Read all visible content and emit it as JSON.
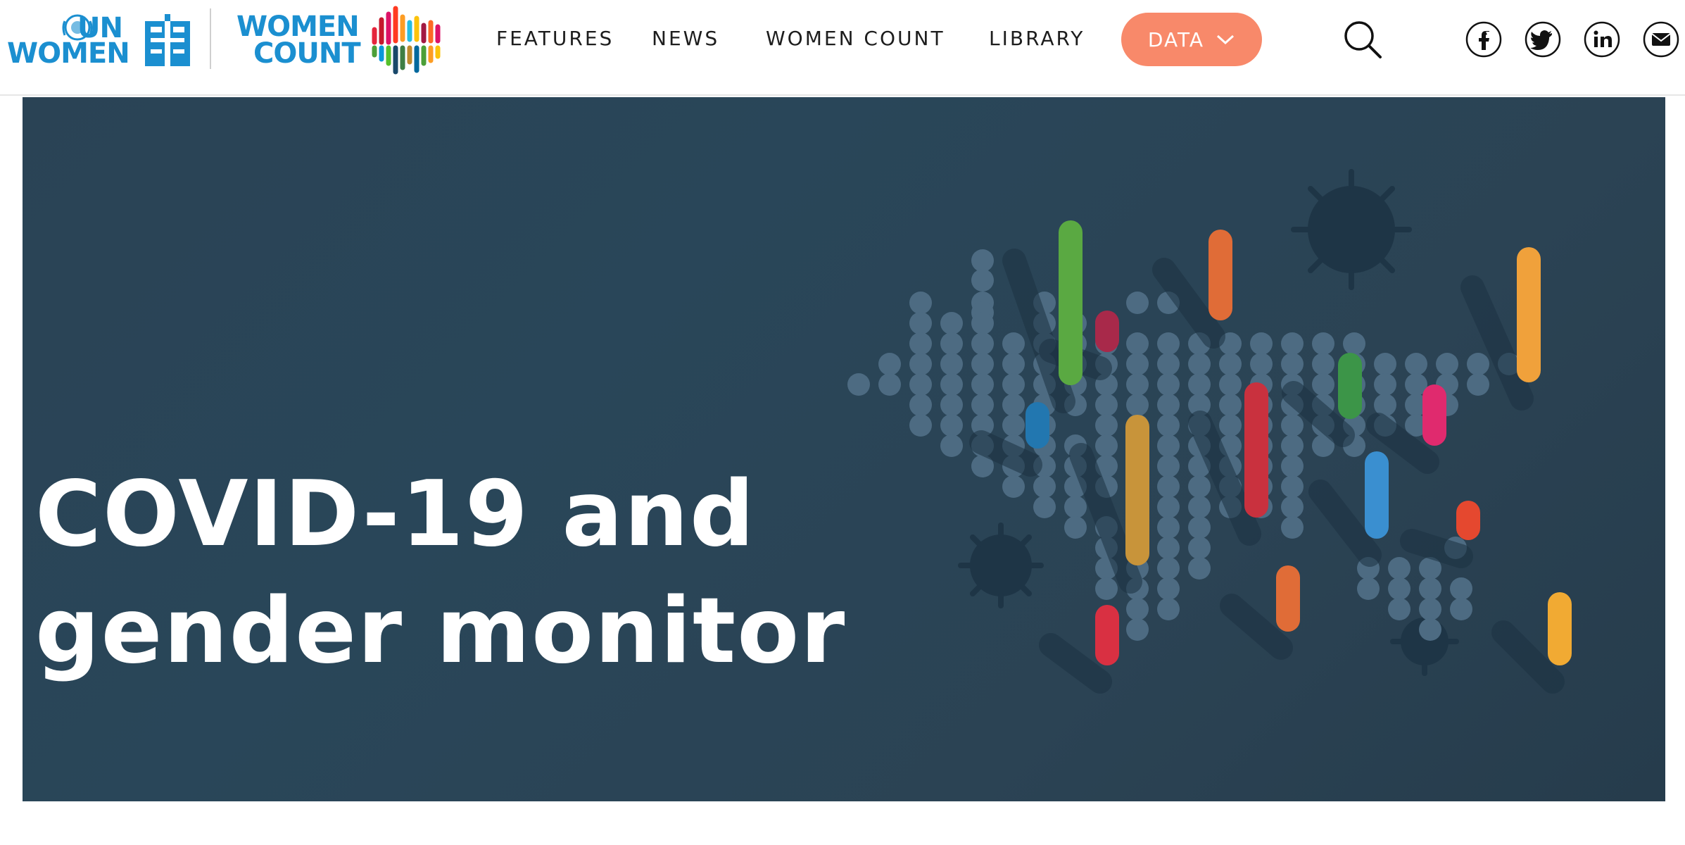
{
  "header": {
    "un_logo": {
      "line1": "UN",
      "line2": "WOMEN"
    },
    "wc_logo": {
      "line1": "WOMEN",
      "line2": "COUNT"
    },
    "nav": [
      {
        "label": "FEATURES"
      },
      {
        "label": "NEWS"
      },
      {
        "label": "WOMEN COUNT"
      },
      {
        "label": "LIBRARY"
      }
    ],
    "data_button": {
      "label": "DATA"
    },
    "social_icons": [
      "facebook-icon",
      "twitter-icon",
      "linkedin-icon",
      "email-icon"
    ]
  },
  "hero": {
    "title_line1": "COVID-19 and",
    "title_line2": "gender monitor"
  },
  "colors": {
    "brand_blue": "#1b8fd0",
    "data_button": "#f8896a",
    "hero_bg": "#2a4355"
  }
}
